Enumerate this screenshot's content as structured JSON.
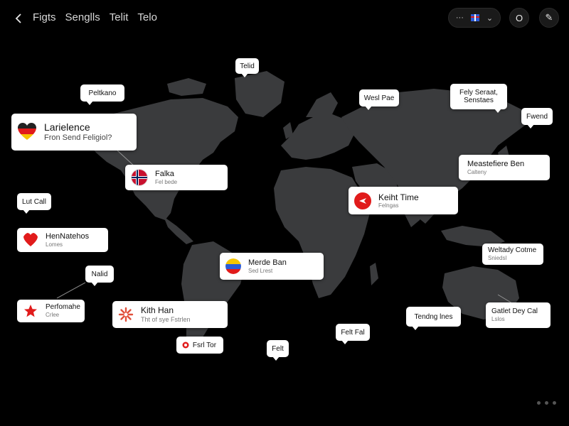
{
  "header": {
    "tabs": [
      "Figts",
      "Senglls",
      "Telit",
      "Telo"
    ],
    "pill_left": "···",
    "pill_right": "⌄",
    "circle1": "O",
    "circle2": "✎"
  },
  "callouts": {
    "telid_top": "Telid",
    "pelicano": "Peltkano",
    "wesl_pae": "Wesl Pae",
    "fely_seraat": [
      "Fely Seraat,",
      "Senstaes"
    ],
    "fwend": "Fwend",
    "latin_card": {
      "title": "Larielence",
      "sub": "Fron Send Feligiol?"
    },
    "falka": {
      "title": "Falka",
      "sub": "Fel bede"
    },
    "meastefiere": {
      "title": "Meastefiere Ben",
      "sub": "Calteny"
    },
    "keiht_time": {
      "title": "Keiht Time",
      "sub": "Felngas"
    },
    "lui_call": "Lut Call",
    "hen_natehos": {
      "title": "HenNatehos",
      "sub": "Lomes"
    },
    "mede_ban": {
      "title": "Merde Ban",
      "sub": "Sed Lrest"
    },
    "welhay_corne": {
      "title": "Weltady Cotme",
      "sub": "Sniedsl"
    },
    "nalid": "Nalid",
    "performance": {
      "title": "Perfomahe",
      "sub": "Crlee"
    },
    "kith_han": {
      "title": "Kith Han",
      "sub": "Tht of sye Fstrlen"
    },
    "tending_hes": "Tendng lnes",
    "gatlet_dey": {
      "title": "Gatlet Dey Cal",
      "sub": "Lslos"
    },
    "felt_fal": "Felt Fal",
    "fsit_tor": "Fsrl Tor",
    "felt": "Felt"
  },
  "colors": {
    "background": "#000000",
    "land": "#3a3b3d",
    "callout_bg": "#ffffff",
    "accent_red": "#e11b1b"
  }
}
